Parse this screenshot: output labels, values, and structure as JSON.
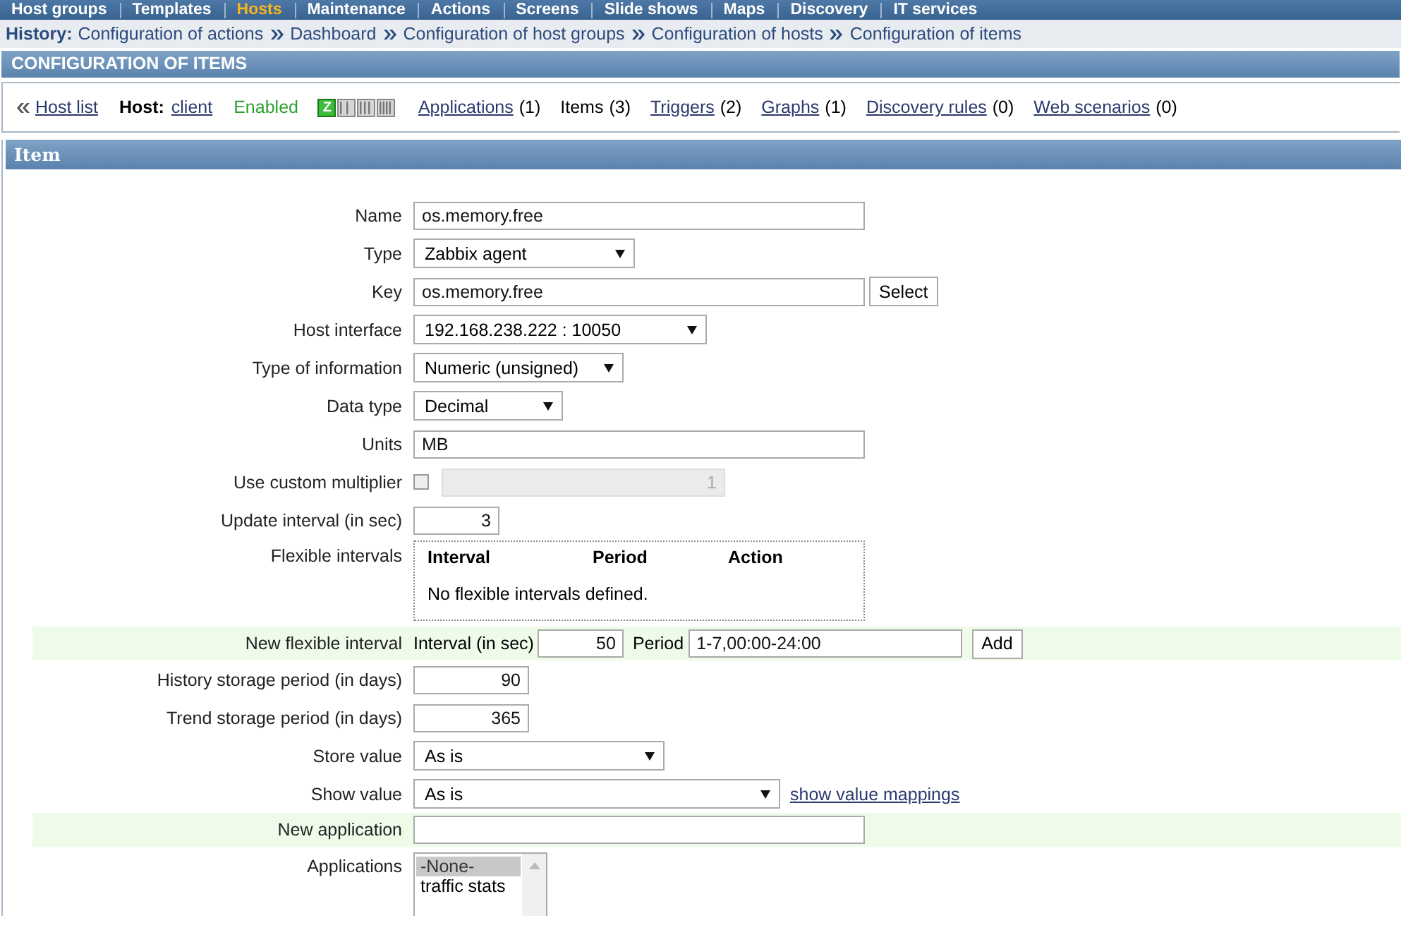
{
  "main_menu": [
    {
      "label": "Host groups",
      "selected": false
    },
    {
      "label": "Templates",
      "selected": false
    },
    {
      "label": "Hosts",
      "selected": true
    },
    {
      "label": "Maintenance",
      "selected": false
    },
    {
      "label": "Actions",
      "selected": false
    },
    {
      "label": "Screens",
      "selected": false
    },
    {
      "label": "Slide shows",
      "selected": false
    },
    {
      "label": "Maps",
      "selected": false
    },
    {
      "label": "Discovery",
      "selected": false
    },
    {
      "label": "IT services",
      "selected": false
    }
  ],
  "history": {
    "label": "History:",
    "items": [
      "Configuration of actions",
      "Dashboard",
      "Configuration of host groups",
      "Configuration of hosts",
      "Configuration of items"
    ]
  },
  "page_title": "CONFIGURATION OF ITEMS",
  "host_bar": {
    "back_link": "Host list",
    "host_label": "Host:",
    "host": "client",
    "status": "Enabled",
    "availability": [
      {
        "kind": "zabbix",
        "label": "Z",
        "available": true
      },
      {
        "kind": "snmp",
        "available": false
      },
      {
        "kind": "jmx",
        "available": false
      },
      {
        "kind": "ipmi",
        "available": false
      }
    ],
    "tabs": [
      {
        "label": "Applications",
        "count": "(1)",
        "selected": false
      },
      {
        "label": "Items",
        "count": "(3)",
        "selected": true
      },
      {
        "label": "Triggers",
        "count": "(2)",
        "selected": false
      },
      {
        "label": "Graphs",
        "count": "(1)",
        "selected": false
      },
      {
        "label": "Discovery rules",
        "count": "(0)",
        "selected": false
      },
      {
        "label": "Web scenarios",
        "count": "(0)",
        "selected": false
      }
    ]
  },
  "form": {
    "title": "Item",
    "rows": [
      {
        "kind": "text",
        "label": "Name",
        "value": "os.memory.free",
        "highlighted": false
      },
      {
        "kind": "select",
        "label": "Type",
        "value": "Zabbix agent",
        "highlighted": false
      },
      {
        "kind": "text",
        "label": "Key",
        "value": "os.memory.free",
        "button": "Select",
        "highlighted": false
      },
      {
        "kind": "select",
        "label": "Host interface",
        "value": "192.168.238.222 : 10050",
        "highlighted": false
      },
      {
        "kind": "select",
        "label": "Type of information",
        "value": "Numeric (unsigned)",
        "highlighted": false
      },
      {
        "kind": "select",
        "label": "Data type",
        "value": "Decimal",
        "highlighted": false
      },
      {
        "kind": "text",
        "label": "Units",
        "value": "MB",
        "highlighted": false
      },
      {
        "kind": "multiplier",
        "label": "Use custom multiplier",
        "checked": false,
        "value": "1",
        "disabled": true,
        "highlighted": false
      },
      {
        "kind": "number",
        "label": "Update interval (in sec)",
        "value": "3",
        "highlighted": false
      },
      {
        "kind": "table",
        "label": "Flexible intervals",
        "columns": [
          "Interval",
          "Period",
          "Action"
        ],
        "empty_text": "No flexible intervals defined.",
        "highlighted": false
      },
      {
        "kind": "interval",
        "label": "New flexible interval",
        "interval_label": "Interval (in sec)",
        "interval": "50",
        "period_label": "Period",
        "period": "1-7,00:00-24:00",
        "button": "Add",
        "highlighted": true
      },
      {
        "kind": "number",
        "label": "History storage period (in days)",
        "value": "90",
        "highlighted": false
      },
      {
        "kind": "number",
        "label": "Trend storage period (in days)",
        "value": "365",
        "highlighted": false
      },
      {
        "kind": "select",
        "label": "Store value",
        "value": "As is",
        "highlighted": false
      },
      {
        "kind": "select",
        "label": "Show value",
        "value": "As is",
        "link": "show value mappings",
        "highlighted": false
      },
      {
        "kind": "text",
        "label": "New application",
        "highlighted": true
      },
      {
        "kind": "listbox",
        "label": "Applications",
        "options": [
          {
            "label": "-None-",
            "selected": true
          },
          {
            "label": "traffic stats",
            "selected": false
          }
        ],
        "highlighted": false
      }
    ]
  }
}
